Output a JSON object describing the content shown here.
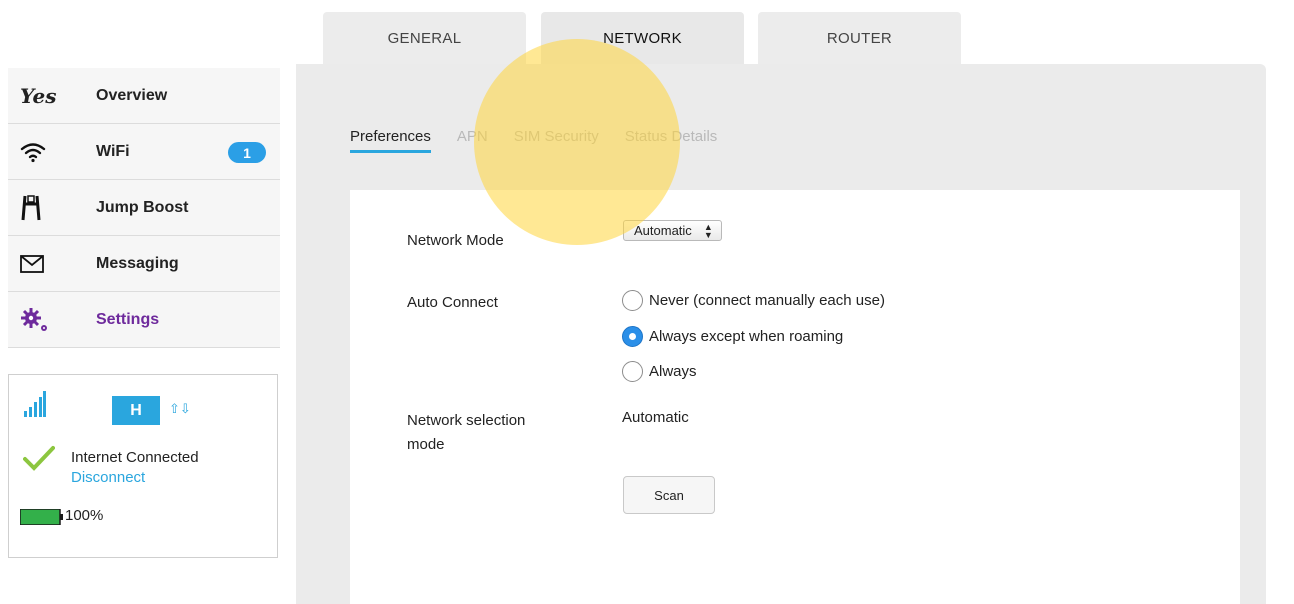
{
  "top_tabs": [
    {
      "label": "GENERAL"
    },
    {
      "label": "NETWORK"
    },
    {
      "label": "ROUTER"
    }
  ],
  "sub_tabs": [
    {
      "label": "Preferences"
    },
    {
      "label": "APN"
    },
    {
      "label": "SIM Security"
    },
    {
      "label": "Status Details"
    }
  ],
  "sidebar": {
    "logo_text": "Yes",
    "items": [
      {
        "label": "Overview",
        "icon": "yes-logo-icon"
      },
      {
        "label": "WiFi",
        "icon": "wifi-icon",
        "badge": "1"
      },
      {
        "label": "Jump Boost",
        "icon": "jump-boost-icon"
      },
      {
        "label": "Messaging",
        "icon": "envelope-icon"
      },
      {
        "label": "Settings",
        "icon": "gear-icon"
      }
    ]
  },
  "status": {
    "network_type": "H",
    "connection_status": "Internet Connected",
    "disconnect_label": "Disconnect",
    "battery": "100%"
  },
  "network_form": {
    "network_mode_label": "Network Mode",
    "network_mode_value": "Automatic",
    "auto_connect_label": "Auto Connect",
    "auto_connect_options": [
      {
        "label": "Never (connect manually each use)",
        "checked": false
      },
      {
        "label": "Always except when roaming",
        "checked": true
      },
      {
        "label": "Always",
        "checked": false
      }
    ],
    "selection_mode_label_line1": "Network selection",
    "selection_mode_label_line2": "mode",
    "selection_mode_value": "Automatic",
    "scan_label": "Scan"
  },
  "colors": {
    "accent": "#2aa6de",
    "settings_purple": "#6e2a9c",
    "checkmark_green": "#8cc63f",
    "battery_green": "#33b04a"
  }
}
